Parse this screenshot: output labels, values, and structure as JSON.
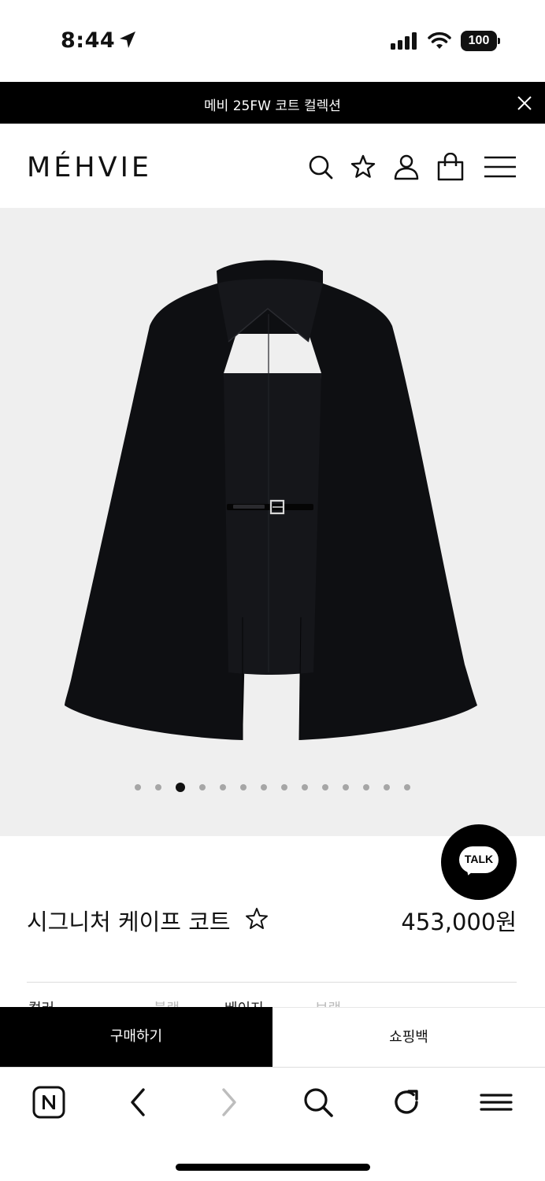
{
  "status_bar": {
    "time": "8:44",
    "battery": "100"
  },
  "announcement": {
    "text": "메비 25FW 코트 컬렉션"
  },
  "header": {
    "logo": "MÉHVIE",
    "icons": [
      "search-icon",
      "star-icon",
      "account-icon",
      "shopping-bag-icon",
      "menu-icon"
    ]
  },
  "gallery": {
    "slide_count": 14,
    "active_index": 2
  },
  "talk": {
    "label": "TALK"
  },
  "product": {
    "name": "시그니처 케이프 코트",
    "price": "453,000원"
  },
  "options_peek": {
    "label1": "컬러",
    "value1": "블랙",
    "label2": "베이지",
    "value2": "브랙"
  },
  "actions": {
    "buy_label": "구매하기",
    "bag_label": "쇼핑백"
  },
  "browser_bar": {
    "icons": [
      "naver-icon",
      "back-icon",
      "forward-icon",
      "search-icon",
      "refresh-icon",
      "menu-icon"
    ]
  },
  "colors": {
    "announcement_bg": "#000000",
    "hero_bg": "#efefef",
    "buy_bg": "#000000",
    "dot_active": "#111111",
    "dot_inactive": "#a6a6a6"
  }
}
